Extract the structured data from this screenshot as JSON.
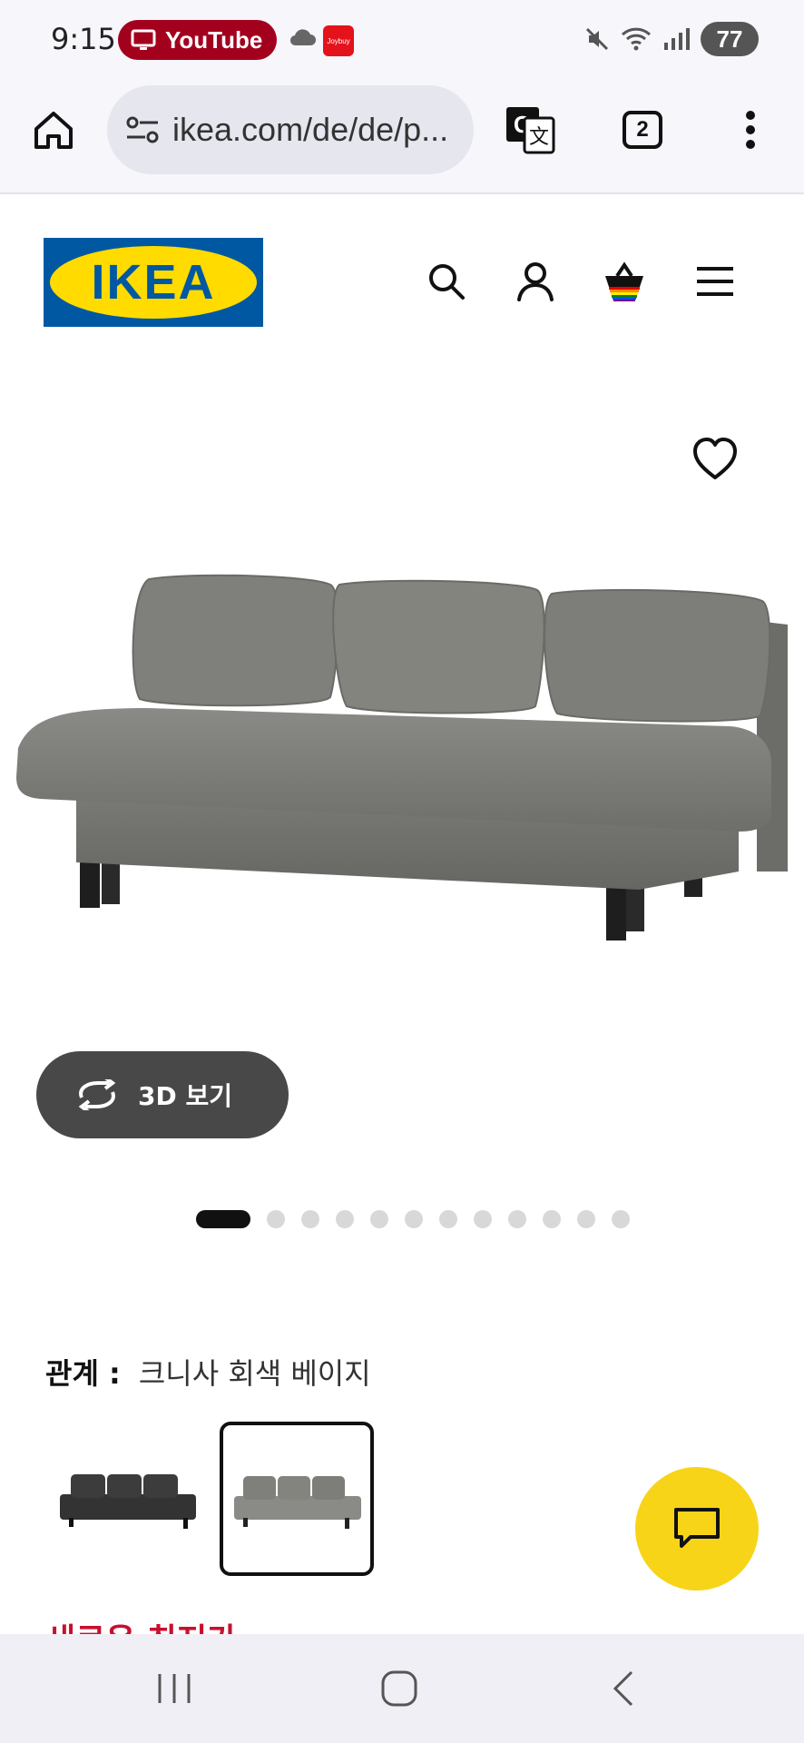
{
  "status_bar": {
    "time": "9:15",
    "notification_app": "YouTube",
    "notification_color": "#a3001e",
    "small_app_label": "Joybuy",
    "battery": "77"
  },
  "browser": {
    "url": "ikea.com/de/de/p...",
    "tab_count": "2"
  },
  "ikea": {
    "logo_text": "IKEA",
    "brand_blue": "#0058a3",
    "brand_yellow": "#ffdb00"
  },
  "product": {
    "view_3d_label": "3D 보기",
    "carousel_total": 12,
    "carousel_active": 1,
    "variant_key": "관계 :",
    "variant_value": "크니사 회색 베이지",
    "price_label": "새로운 최저가",
    "price_color": "#c8102e"
  },
  "icons": [
    "home-icon",
    "site-settings-icon",
    "translate-icon",
    "tabs-icon",
    "more-vert-icon",
    "search-icon",
    "account-icon",
    "cart-icon",
    "hamburger-menu-icon",
    "heart-icon",
    "rotate-3d-icon",
    "chat-icon",
    "recent-apps-icon",
    "home-nav-icon",
    "back-icon"
  ]
}
